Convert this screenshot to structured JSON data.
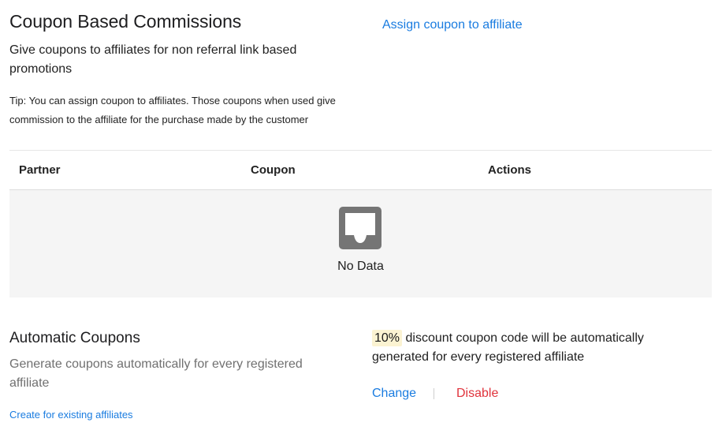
{
  "header": {
    "title": "Coupon Based Commissions",
    "subtitle": "Give coupons to affiliates for non referral link based promotions",
    "tip": "Tip: You can assign coupon to affiliates. Those coupons when used give commission to the affiliate for the purchase made by the customer",
    "assign_link": "Assign coupon to affiliate"
  },
  "table": {
    "columns": [
      "Partner",
      "Coupon",
      "Actions"
    ],
    "rows": [],
    "empty_text": "No Data",
    "empty_icon": "inbox-icon"
  },
  "automatic": {
    "title": "Automatic Coupons",
    "description": "Generate coupons automatically for every registered affiliate",
    "create_link": "Create for existing affiliates",
    "discount_value": "10%",
    "discount_text": "discount coupon code will be automatically generated for every registered affiliate",
    "change_link": "Change",
    "disable_link": "Disable"
  },
  "colors": {
    "link": "#1a7ce0",
    "danger": "#e0333c",
    "highlight": "#fbf3d2",
    "empty_bg": "#f5f5f5"
  }
}
